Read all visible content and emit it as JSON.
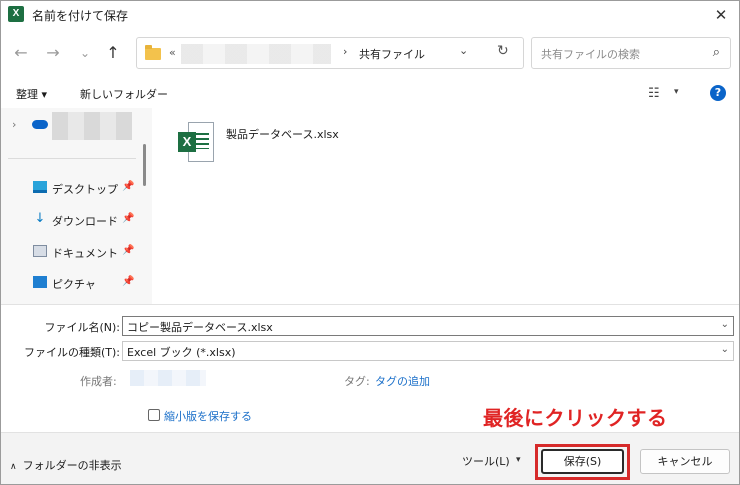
{
  "window": {
    "app_icon": "X",
    "title": "名前を付けて保存",
    "close": "✕"
  },
  "nav": {
    "back_icon": "←",
    "forward_icon": "→",
    "recent_icon": "⌄",
    "up_icon": "↑",
    "address_prefix": "«",
    "address_separator": "›",
    "address_current": "共有ファイル",
    "address_dropdown": "⌄",
    "refresh_icon": "↻",
    "search_placeholder": "共有ファイルの検索",
    "search_icon": "⌕"
  },
  "toolbar": {
    "organize": "整理 ▾",
    "new_folder": "新しいフォルダー",
    "view_icon": "☷",
    "view_dropdown": "▾",
    "help": "?"
  },
  "sidebar": {
    "expand_icon": "›",
    "items": [
      {
        "label": "デスクトップ",
        "icon": "desktop-icon",
        "pin": "📌"
      },
      {
        "label": "ダウンロード",
        "icon": "download-icon",
        "pin": "📌"
      },
      {
        "label": "ドキュメント",
        "icon": "document-icon",
        "pin": "📌"
      },
      {
        "label": "ピクチャ",
        "icon": "pictures-icon",
        "pin": "📌"
      }
    ]
  },
  "files": [
    {
      "name": "製品データベース.xlsx",
      "icon": "excel-file-icon"
    }
  ],
  "form": {
    "filename_label": "ファイル名(N):",
    "filename_value": "コピー製品データベース.xlsx",
    "filetype_label": "ファイルの種類(T):",
    "filetype_value": "Excel ブック (*.xlsx)",
    "dropdown_icon": "⌄",
    "author_label": "作成者:",
    "tags_label": "タグ:",
    "tags_link": "タグの追加",
    "thumbnail_label": "縮小版を保存する"
  },
  "annotation": "最後にクリックする",
  "footer": {
    "hide_folders_icon": "∧",
    "hide_folders": "フォルダーの非表示",
    "tools": "ツール(L)",
    "tools_dropdown": "▾",
    "save": "保存(S)",
    "cancel": "キャンセル"
  },
  "colors": {
    "accent": "#0a64c9",
    "excel_green": "#1d6f42",
    "annotation_red": "#e02424",
    "highlight_red": "#d62a2a"
  }
}
